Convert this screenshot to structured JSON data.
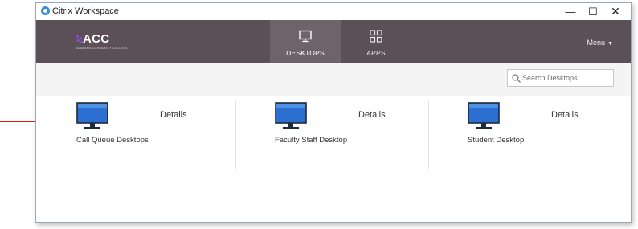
{
  "window": {
    "title": "Citrix Workspace",
    "controls": {
      "minimize": "—",
      "maximize": "☐",
      "close": "✕"
    }
  },
  "header": {
    "logo_text": "ACC",
    "logo_subtitle": "ALABAMA COMMUNITY COLLEGE",
    "tabs": [
      {
        "label": "DESKTOPS",
        "icon": "monitor-icon",
        "active": true
      },
      {
        "label": "APPS",
        "icon": "apps-grid-icon",
        "active": false
      }
    ],
    "menu_label": "Menu"
  },
  "toolbar": {
    "search_placeholder": "Search Desktops"
  },
  "desktops": [
    {
      "name": "Call Queue Desktops",
      "details_label": "Details"
    },
    {
      "name": "Faculty Staff Desktop",
      "details_label": "Details"
    },
    {
      "name": "Student Desktop",
      "details_label": "Details"
    }
  ],
  "colors": {
    "header_bg": "#5c5057",
    "active_tab_bg": "#6e6369",
    "monitor_blue": "#2b6fd1",
    "annotation_arrow": "#e0141b"
  }
}
